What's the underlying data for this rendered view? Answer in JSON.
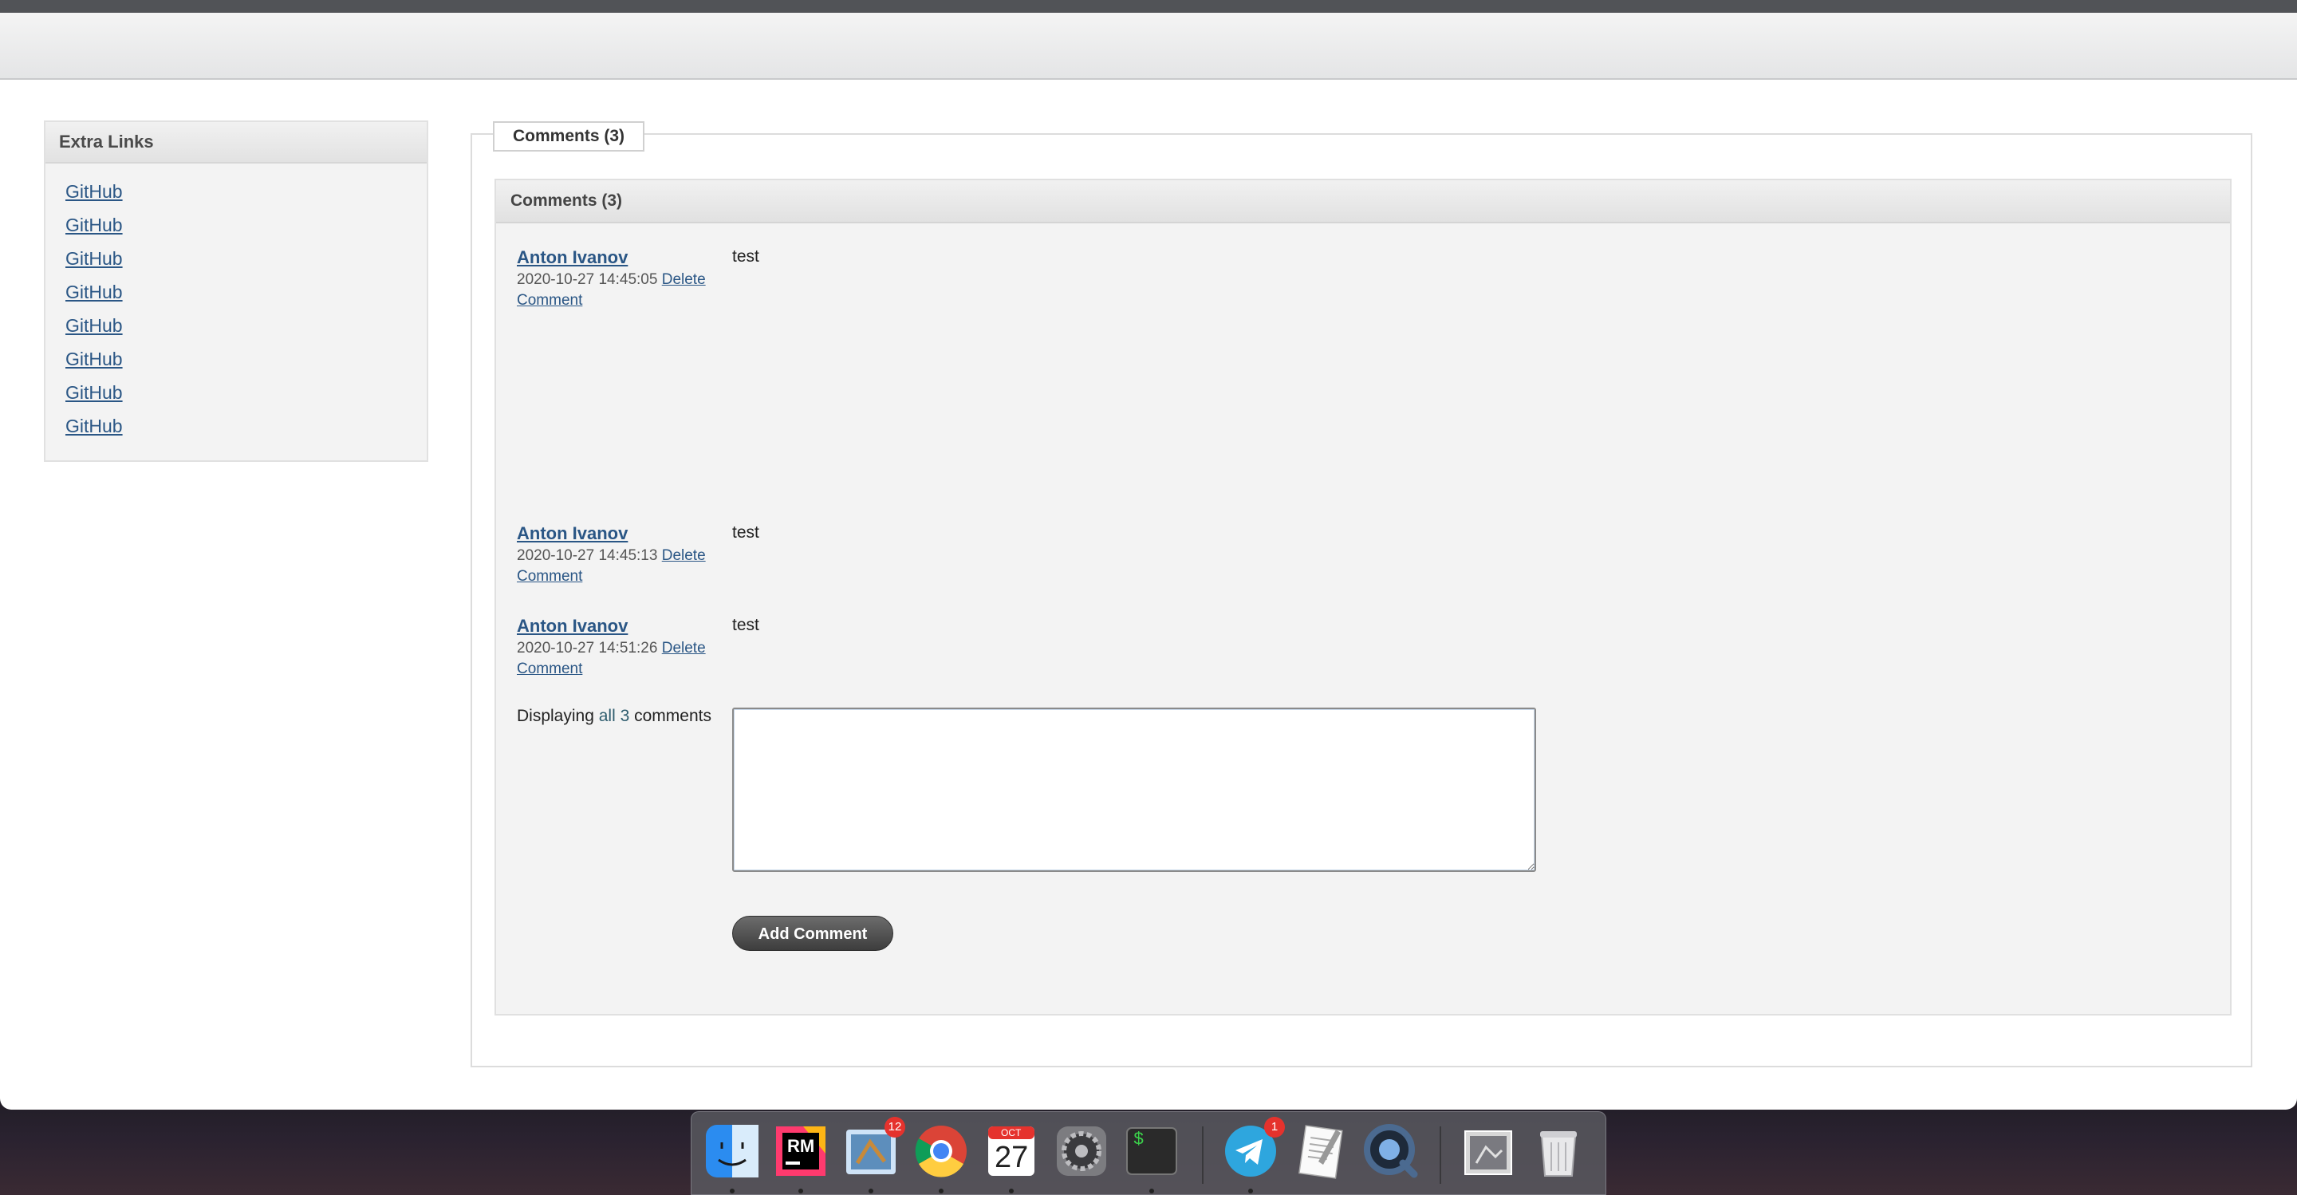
{
  "sidebar": {
    "title": "Extra Links",
    "links": [
      "GitHub",
      "GitHub",
      "GitHub",
      "GitHub",
      "GitHub",
      "GitHub",
      "GitHub",
      "GitHub"
    ]
  },
  "tabs": {
    "active": "Comments (3)"
  },
  "comments_panel": {
    "header": "Comments (3)",
    "comments": [
      {
        "author": "Anton Ivanov",
        "timestamp": "2020-10-27 14:45:05",
        "delete_label": "Delete Comment",
        "body": "test"
      },
      {
        "author": "Anton Ivanov",
        "timestamp": "2020-10-27 14:45:13",
        "delete_label": "Delete Comment",
        "body": "test"
      },
      {
        "author": "Anton Ivanov",
        "timestamp": "2020-10-27 14:51:26",
        "delete_label": "Delete Comment",
        "body": "test"
      }
    ],
    "displaying": {
      "prefix": "Displaying",
      "all": "all",
      "count": "3",
      "suffix": "comments"
    },
    "textarea_value": "",
    "add_button": "Add Comment"
  },
  "dock": {
    "apps": [
      {
        "name": "Finder",
        "icon": "finder-icon",
        "running": true
      },
      {
        "name": "RubyMine",
        "icon": "rubymine-icon",
        "label": "RM",
        "running": true
      },
      {
        "name": "Mail",
        "icon": "mail-icon",
        "badge": "12",
        "running": true
      },
      {
        "name": "Chrome",
        "icon": "chrome-icon",
        "running": true
      },
      {
        "name": "Calendar",
        "icon": "calendar-icon",
        "month": "OCT",
        "day": "27",
        "running": true
      },
      {
        "name": "System Preferences",
        "icon": "gear-icon",
        "running": false
      },
      {
        "name": "Terminal",
        "icon": "terminal-icon",
        "label": "$",
        "running": true
      },
      {
        "name": "Telegram",
        "icon": "telegram-icon",
        "badge": "1",
        "running": true
      },
      {
        "name": "TextEdit",
        "icon": "textedit-icon",
        "running": false
      },
      {
        "name": "QuickTime",
        "icon": "quicktime-icon",
        "running": false
      },
      {
        "name": "Downloads",
        "icon": "downloads-stack-icon",
        "running": false
      },
      {
        "name": "Trash",
        "icon": "trash-icon",
        "running": false
      }
    ]
  },
  "colors": {
    "link": "#2a5685",
    "panel_bg": "#f3f3f3",
    "button_dark": "#3d3d3d"
  }
}
